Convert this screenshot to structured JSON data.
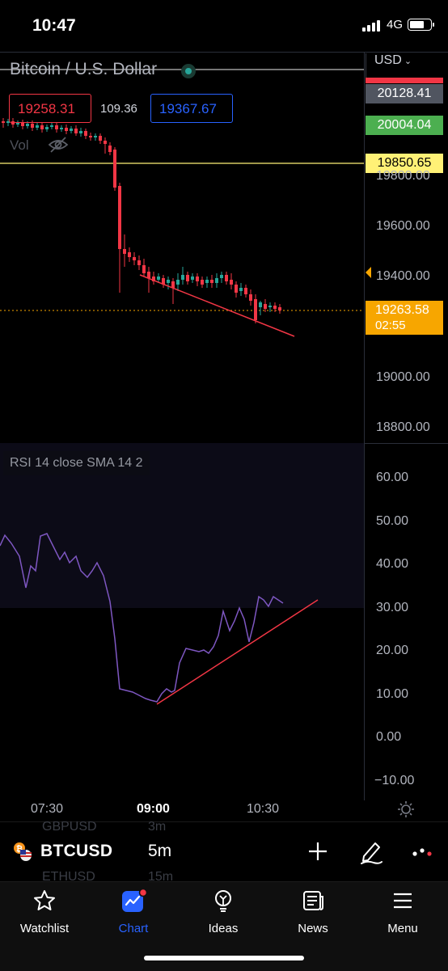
{
  "status": {
    "time": "10:47",
    "network": "4G"
  },
  "header": {
    "title": "Bitcoin / U.S. Dollar",
    "currency": "USD",
    "sell_price": "19258.31",
    "spread": "109.36",
    "buy_price": "19367.67",
    "vol_label": "Vol"
  },
  "price_tags": {
    "top_dark": "20128.41",
    "green": "20004.04",
    "yellow": "19850.65",
    "current_price": "19263.58",
    "countdown": "02:55"
  },
  "price_axis": [
    "19800.00",
    "19600.00",
    "19400.00",
    "19000.00",
    "18800.00"
  ],
  "rsi": {
    "label": "RSI 14 close SMA 14 2",
    "axis": [
      "60.00",
      "50.00",
      "40.00",
      "30.00",
      "20.00",
      "10.00",
      "0.00",
      "−10.00"
    ]
  },
  "time_axis": [
    "07:30",
    "09:00",
    "10:30"
  ],
  "toolbar": {
    "symbol": "BTCUSD",
    "interval": "5m",
    "ghost_above_symbol": "GBPUSD",
    "ghost_above_interval": "3m",
    "ghost_below_symbol": "ETHUSD",
    "ghost_below_interval": "15m"
  },
  "nav": {
    "items": [
      {
        "label": "Watchlist",
        "icon": "star-icon"
      },
      {
        "label": "Chart",
        "icon": "chart-icon"
      },
      {
        "label": "Ideas",
        "icon": "lightbulb-icon"
      },
      {
        "label": "News",
        "icon": "news-icon"
      },
      {
        "label": "Menu",
        "icon": "menu-icon"
      }
    ]
  },
  "colors": {
    "up": "#26a69a",
    "down": "#f23645",
    "accent": "#2962ff",
    "yellow": "#fff176",
    "green_tag": "#4caf50",
    "orange": "#f7a600",
    "rsi_line": "#7e57c2"
  }
}
